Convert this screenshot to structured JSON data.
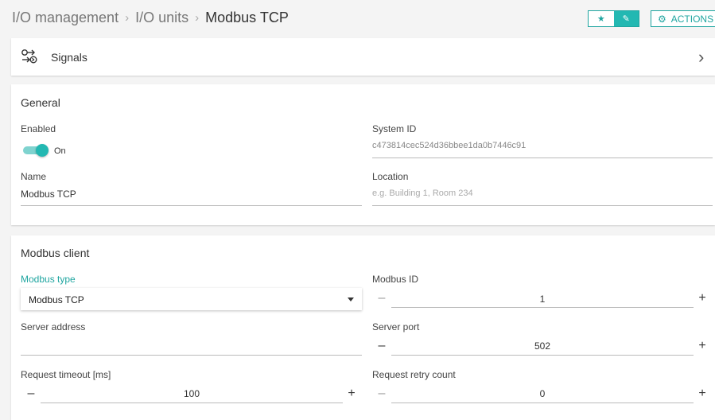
{
  "breadcrumb": {
    "items": [
      "I/O management",
      "I/O units"
    ],
    "separator": "›",
    "current": "Modbus TCP"
  },
  "toolbar": {
    "star_icon": "star-icon",
    "edit_icon": "pencil-icon",
    "actions_label": "ACTIONS",
    "accent_color": "#23b8b2"
  },
  "signals": {
    "label": "Signals"
  },
  "general": {
    "title": "General",
    "enabled_label": "Enabled",
    "enabled_state": "On",
    "system_id_label": "System ID",
    "system_id_value": "c473814cec524d36bbee1da0b7446c91",
    "name_label": "Name",
    "name_value": "Modbus TCP",
    "location_label": "Location",
    "location_placeholder": "e.g. Building 1, Room 234"
  },
  "modbus": {
    "title": "Modbus client",
    "type_label": "Modbus type",
    "type_value": "Modbus TCP",
    "id_label": "Modbus ID",
    "id_value": "1",
    "server_address_label": "Server address",
    "server_address_value": "",
    "server_port_label": "Server port",
    "server_port_value": "502",
    "timeout_label": "Request timeout [ms]",
    "timeout_value": "100",
    "retry_label": "Request retry count",
    "retry_value": "0",
    "minus": "–",
    "plus": "+"
  }
}
